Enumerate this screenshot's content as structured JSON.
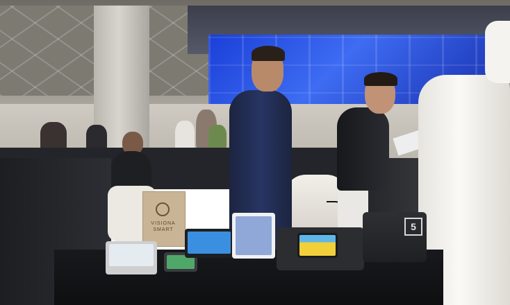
{
  "scene": {
    "setting": "exhibition-booth",
    "colors": {
      "led_wall": "#2b52e0",
      "suit": "#283563",
      "table": "#141518",
      "robe": "#f4f2ee",
      "kiosk_screen": "#f2d03a",
      "tablet_screen": "#3b8fe0"
    }
  },
  "booth_sign": {
    "line1": "VISIONA",
    "line2": "SMART"
  },
  "printer": {
    "mark": "5"
  }
}
